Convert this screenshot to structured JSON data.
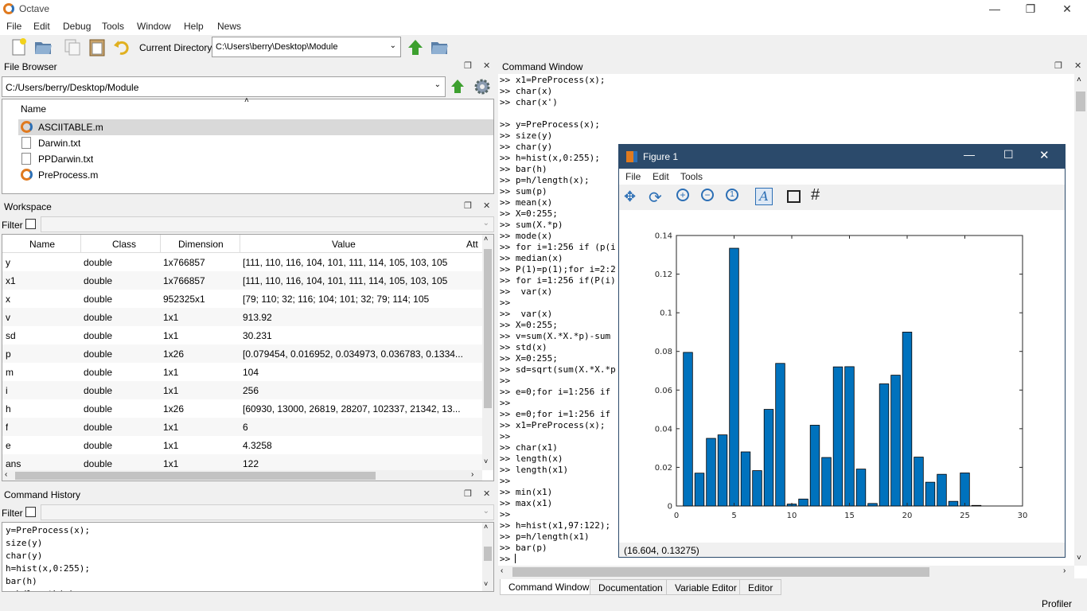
{
  "app": {
    "title": "Octave"
  },
  "menubar": [
    "File",
    "Edit",
    "Debug",
    "Tools",
    "Window",
    "Help",
    "News"
  ],
  "toolbar": {
    "current_directory_label": "Current Directory:",
    "current_directory": "C:\\Users\\berry\\Desktop\\Module"
  },
  "file_browser": {
    "title": "File Browser",
    "path": "C:/Users/berry/Desktop/Module",
    "column": "Name",
    "files": [
      {
        "name": "ASCIITABLE.m",
        "icon": "octave-file-icon"
      },
      {
        "name": "Darwin.txt",
        "icon": "text-file-icon"
      },
      {
        "name": "PPDarwin.txt",
        "icon": "text-file-icon"
      },
      {
        "name": "PreProcess.m",
        "icon": "octave-file-icon"
      }
    ]
  },
  "workspace": {
    "title": "Workspace",
    "filter_label": "Filter",
    "columns": [
      "Name",
      "Class",
      "Dimension",
      "Value",
      "Att"
    ],
    "rows": [
      [
        "y",
        "double",
        "1x766857",
        "[111, 110, 116, 104, 101, 111, 114, 105, 103, 105"
      ],
      [
        "x1",
        "double",
        "1x766857",
        "[111, 110, 116, 104, 101, 111, 114, 105, 103, 105"
      ],
      [
        "x",
        "double",
        "952325x1",
        "[79; 110; 32; 116; 104; 101; 32; 79; 114; 105"
      ],
      [
        "v",
        "double",
        "1x1",
        "913.92"
      ],
      [
        "sd",
        "double",
        "1x1",
        "30.231"
      ],
      [
        "p",
        "double",
        "1x26",
        "[0.079454, 0.016952, 0.034973, 0.036783, 0.1334..."
      ],
      [
        "m",
        "double",
        "1x1",
        "104"
      ],
      [
        "i",
        "double",
        "1x1",
        "256"
      ],
      [
        "h",
        "double",
        "1x26",
        "[60930, 13000, 26819, 28207, 102337, 21342, 13..."
      ],
      [
        "f",
        "double",
        "1x1",
        "6"
      ],
      [
        "e",
        "double",
        "1x1",
        "4.3258"
      ],
      [
        "ans",
        "double",
        "1x1",
        "122"
      ]
    ]
  },
  "command_history": {
    "title": "Command History",
    "filter_label": "Filter",
    "lines": [
      "y=PreProcess(x);",
      "size(y)",
      "char(y)",
      "h=hist(x,0:255);",
      "bar(h)",
      "p=h/length(x);"
    ]
  },
  "command_window": {
    "title": "Command Window",
    "lines": [
      ">> x1=PreProcess(x);",
      ">> char(x)",
      ">> char(x')",
      "",
      ">> y=PreProcess(x);",
      ">> size(y)",
      ">> char(y)",
      ">> h=hist(x,0:255);",
      ">> bar(h)",
      ">> p=h/length(x);",
      ">> sum(p)",
      ">> mean(x)",
      ">> X=0:255;",
      ">> sum(X.*p)",
      ">> mode(x)",
      ">> for i=1:256 if (p(i",
      ">> median(x)",
      ">> P(1)=p(1);for i=2:2",
      ">> for i=1:256 if(P(i)",
      ">>  var(x)",
      ">>",
      ">>  var(x)",
      ">> X=0:255;",
      ">> v=sum(X.*X.*p)-sum",
      ">> std(x)",
      ">> X=0:255;",
      ">> sd=sqrt(sum(X.*X.*p",
      ">>",
      ">> e=0;for i=1:256 if",
      ">>",
      ">> e=0;for i=1:256 if",
      ">> x1=PreProcess(x);",
      ">>",
      ">> char(x1)",
      ">> length(x)",
      ">> length(x1)",
      ">>",
      ">> min(x1)",
      ">> max(x1)",
      ">>",
      ">> h=hist(x1,97:122);",
      ">> p=h/length(x1)",
      ">> bar(p)",
      ">> "
    ],
    "tabs": [
      "Command Window",
      "Documentation",
      "Variable Editor",
      "Editor"
    ]
  },
  "status": {
    "profiler": "Profiler"
  },
  "figure": {
    "title": "Figure 1",
    "menu": [
      "File",
      "Edit",
      "Tools"
    ],
    "status": "(16.604, 0.13275)"
  },
  "chart_data": {
    "type": "bar",
    "x": [
      1,
      2,
      3,
      4,
      5,
      6,
      7,
      8,
      9,
      10,
      11,
      12,
      13,
      14,
      15,
      16,
      17,
      18,
      19,
      20,
      21,
      22,
      23,
      24,
      25,
      26
    ],
    "values": [
      0.0795,
      0.017,
      0.035,
      0.0368,
      0.1334,
      0.028,
      0.0183,
      0.05,
      0.0738,
      0.001,
      0.0036,
      0.0418,
      0.0251,
      0.072,
      0.0721,
      0.0191,
      0.0013,
      0.0632,
      0.0677,
      0.09,
      0.0253,
      0.0123,
      0.0164,
      0.0024,
      0.0171,
      0.0003
    ],
    "xlim": [
      0,
      30
    ],
    "ylim": [
      0,
      0.14
    ],
    "xticks": [
      "0",
      "5",
      "10",
      "15",
      "20",
      "25",
      "30"
    ],
    "yticks": [
      "0",
      "0.02",
      "0.04",
      "0.06",
      "0.08",
      "0.1",
      "0.12",
      "0.14"
    ],
    "bar_color": "#0072bd",
    "grid": false
  }
}
